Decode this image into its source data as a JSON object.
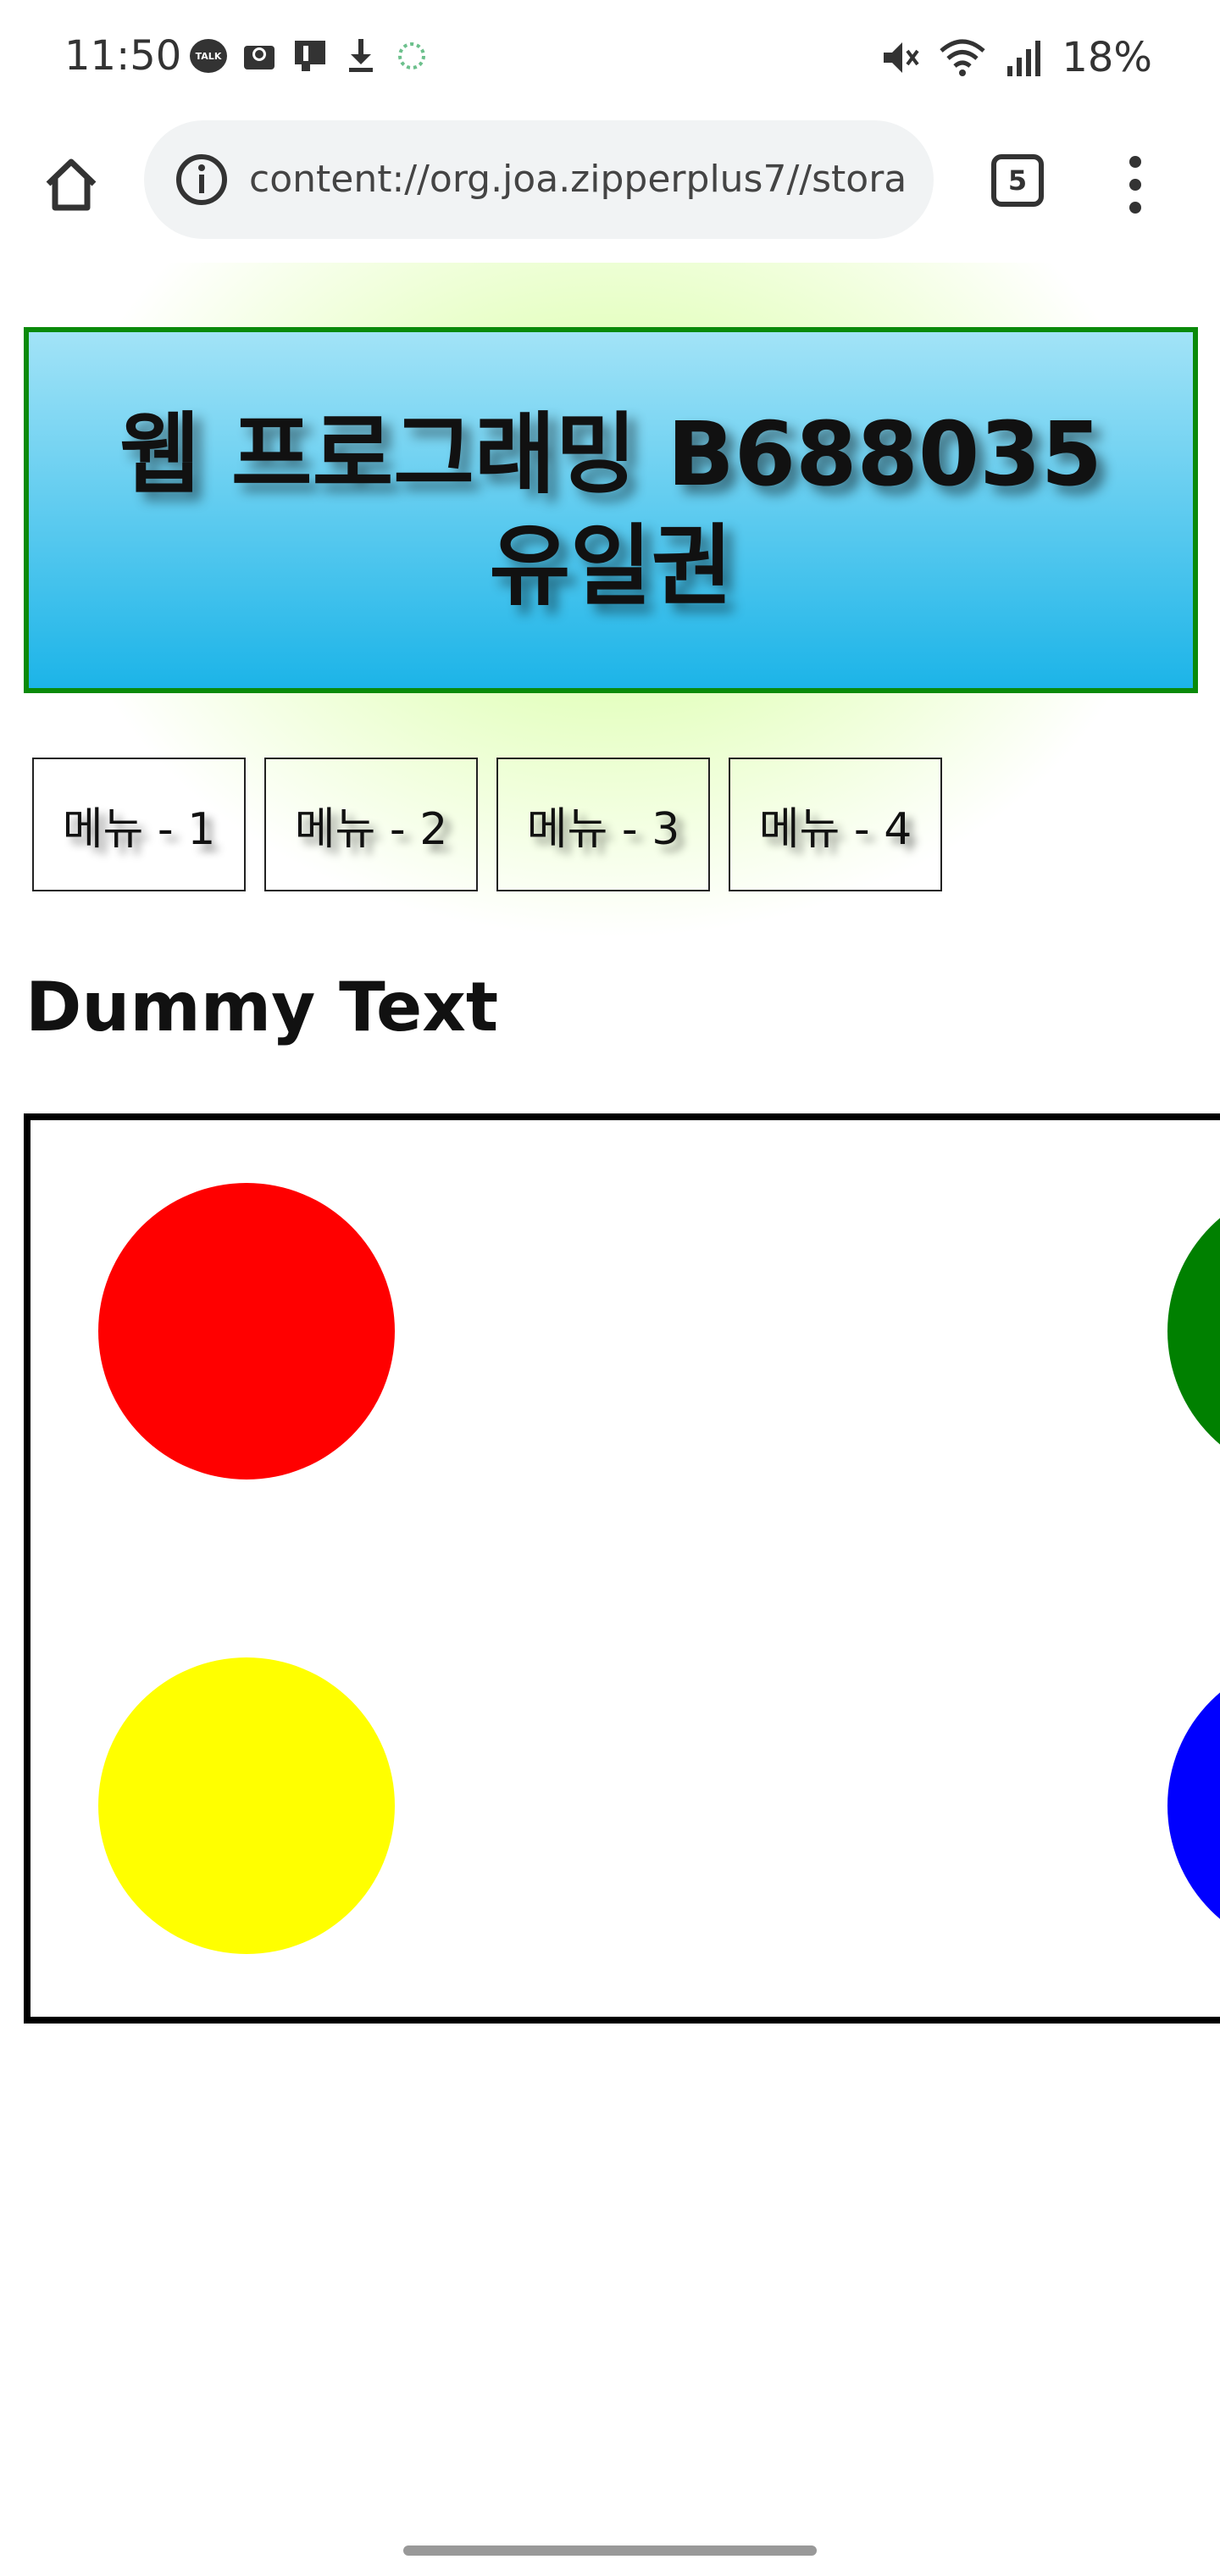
{
  "status_bar": {
    "time": "11:50",
    "talk_label": "TALK",
    "battery": "18%"
  },
  "browser": {
    "url": "content://org.joa.zipperplus7//stora",
    "tab_count": "5"
  },
  "page": {
    "title": "웹 프로그래밍 B688035 유일권",
    "menu": [
      "메뉴 - 1",
      "메뉴 - 2",
      "메뉴 - 3",
      "메뉴 - 4"
    ],
    "heading": "Dummy Text"
  },
  "colors": {
    "title_border": "#0a8a0a",
    "title_gradient_top": "#a2e3f7",
    "title_gradient_bottom": "#1cb4e8",
    "circle_red": "#ff0000",
    "circle_green": "#008000",
    "circle_yellow": "#ffff00",
    "circle_blue": "#0000ff"
  },
  "icons": {
    "home": "home-icon",
    "info": "info-icon",
    "menu": "more-vert-icon"
  }
}
